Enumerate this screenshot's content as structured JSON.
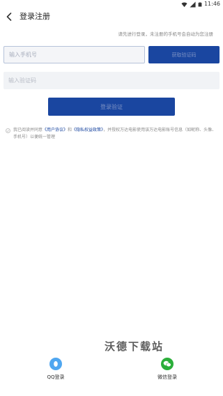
{
  "status_bar": {
    "time": "11:46"
  },
  "header": {
    "title": "登录注册"
  },
  "form": {
    "hint": "请先进行登录，未注册的手机号会自动为您注册",
    "phone_placeholder": "输入手机号",
    "phone_value": "",
    "get_code_label": "获取验证码",
    "code_placeholder": "输入验证码",
    "code_value": "",
    "login_label": "登录验证"
  },
  "agreement": {
    "text_before": "我已阅读并同意",
    "user_agreement": "《用户协议》",
    "and": "和",
    "privacy_policy": "《隐私权益政策》",
    "text_after": "，并授权万达电影使用该万达电影账号信息（如昵称、头像、手机号）以便统一管理"
  },
  "watermark": "沃德下载站",
  "social": {
    "qq_label": "QQ登录",
    "wechat_label": "微信登录"
  },
  "colors": {
    "primary": "#1a46a0",
    "button_text": "#7d92c4",
    "qq": "#4fa6f0",
    "wechat": "#2bae3a"
  }
}
